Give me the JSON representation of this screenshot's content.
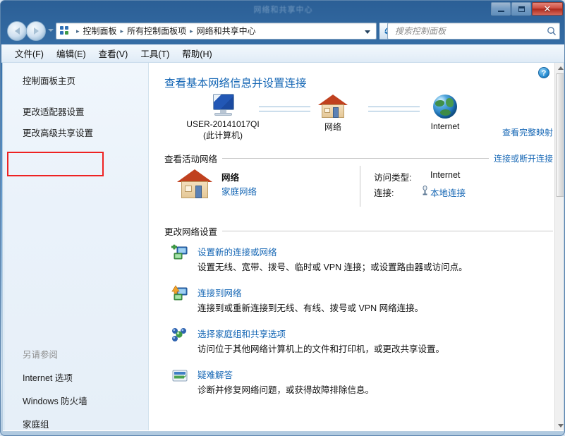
{
  "window": {
    "title": "网络和共享中心",
    "controls": {
      "minimize": "最小化",
      "maximize": "最大化",
      "close": "关闭"
    }
  },
  "nav": {
    "back": "后退",
    "forward": "前进",
    "history_dropdown": "最近访问的位置",
    "refresh": "刷新",
    "breadcrumbs": [
      "控制面板",
      "所有控制面板项",
      "网络和共享中心"
    ],
    "separator": "▸"
  },
  "search": {
    "placeholder": "搜索控制面板",
    "value": ""
  },
  "menubar": {
    "items": [
      "文件(F)",
      "编辑(E)",
      "查看(V)",
      "工具(T)",
      "帮助(H)"
    ]
  },
  "sidebar": {
    "home": "控制面板主页",
    "items": [
      "更改适配器设置",
      "更改高级共享设置"
    ],
    "see_also_heading": "另请参阅",
    "see_also": [
      "Internet 选项",
      "Windows 防火墙",
      "家庭组"
    ]
  },
  "main": {
    "help": "?",
    "heading": "查看基本网络信息并设置连接",
    "view_full_map": "查看完整映射",
    "map": {
      "computer_label": "USER-20141017QI",
      "computer_sub": "(此计算机)",
      "network_label": "网络",
      "internet_label": "Internet"
    },
    "active_networks": {
      "title": "查看活动网络",
      "action": "连接或断开连接",
      "network_name": "网络",
      "network_type": "家庭网络",
      "access_type_label": "访问类型:",
      "access_type_value": "Internet",
      "connections_label": "连接:",
      "connection_value": "本地连接"
    },
    "change_settings": {
      "title": "更改网络设置",
      "tasks": [
        {
          "link": "设置新的连接或网络",
          "desc": "设置无线、宽带、拨号、临时或 VPN 连接；或设置路由器或访问点。",
          "icon": "new-connection-icon"
        },
        {
          "link": "连接到网络",
          "desc": "连接到或重新连接到无线、有线、拨号或 VPN 网络连接。",
          "icon": "connect-to-network-icon"
        },
        {
          "link": "选择家庭组和共享选项",
          "desc": "访问位于其他网络计算机上的文件和打印机，或更改共享设置。",
          "icon": "homegroup-icon"
        },
        {
          "link": "疑难解答",
          "desc": "诊断并修复网络问题，或获得故障排除信息。",
          "icon": "troubleshoot-icon"
        }
      ]
    }
  },
  "annotation": {
    "highlight_target": "更改适配器设置",
    "color": "#ee2222"
  }
}
